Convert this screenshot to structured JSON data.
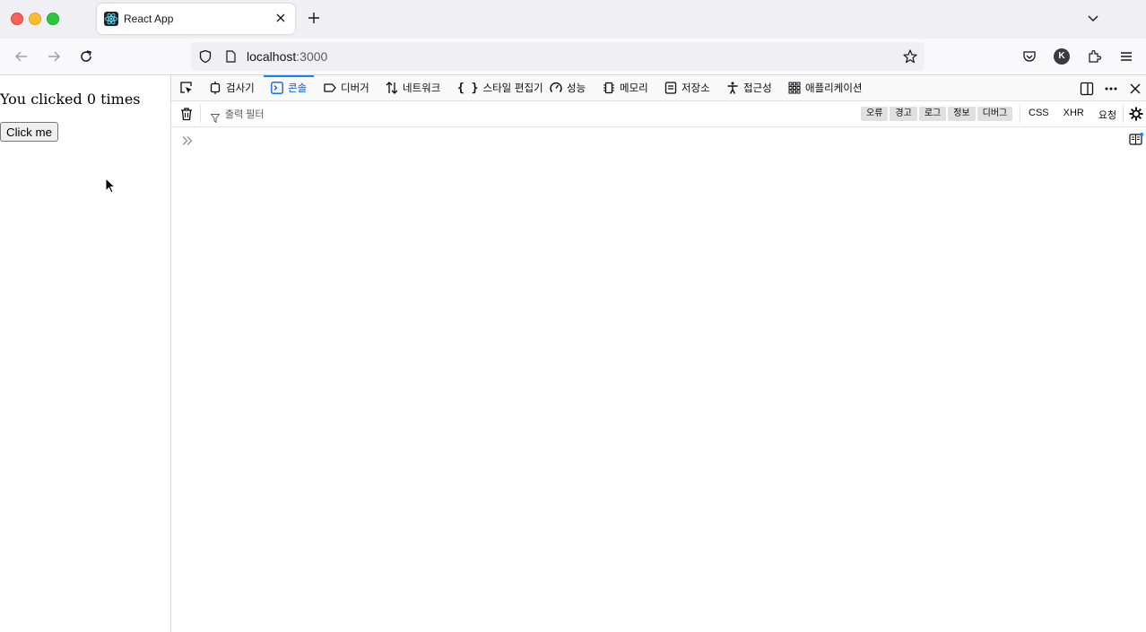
{
  "browser": {
    "tab_title": "React App",
    "url_host": "localhost",
    "url_port": ":3000",
    "avatar_letter": "K"
  },
  "page": {
    "counter_text": "You clicked 0 times",
    "button_label": "Click me"
  },
  "devtools": {
    "tabs": [
      {
        "label": "검사기",
        "icon": "inspector-icon"
      },
      {
        "label": "콘솔",
        "icon": "console-icon"
      },
      {
        "label": "디버거",
        "icon": "debugger-icon"
      },
      {
        "label": "네트워크",
        "icon": "network-icon"
      },
      {
        "label": "스타일 편집기",
        "icon": "style-editor-icon"
      },
      {
        "label": "성능",
        "icon": "performance-icon"
      },
      {
        "label": "메모리",
        "icon": "memory-icon"
      },
      {
        "label": "저장소",
        "icon": "storage-icon"
      },
      {
        "label": "접근성",
        "icon": "accessibility-icon"
      },
      {
        "label": "애플리케이션",
        "icon": "application-icon"
      }
    ],
    "active_tab": "콘솔",
    "filter_placeholder": "출력 필터",
    "levels": [
      "오류",
      "경고",
      "로그",
      "정보",
      "디버그"
    ],
    "request_filters": [
      "CSS",
      "XHR",
      "요청"
    ],
    "accent_color": "#0a84ff"
  }
}
